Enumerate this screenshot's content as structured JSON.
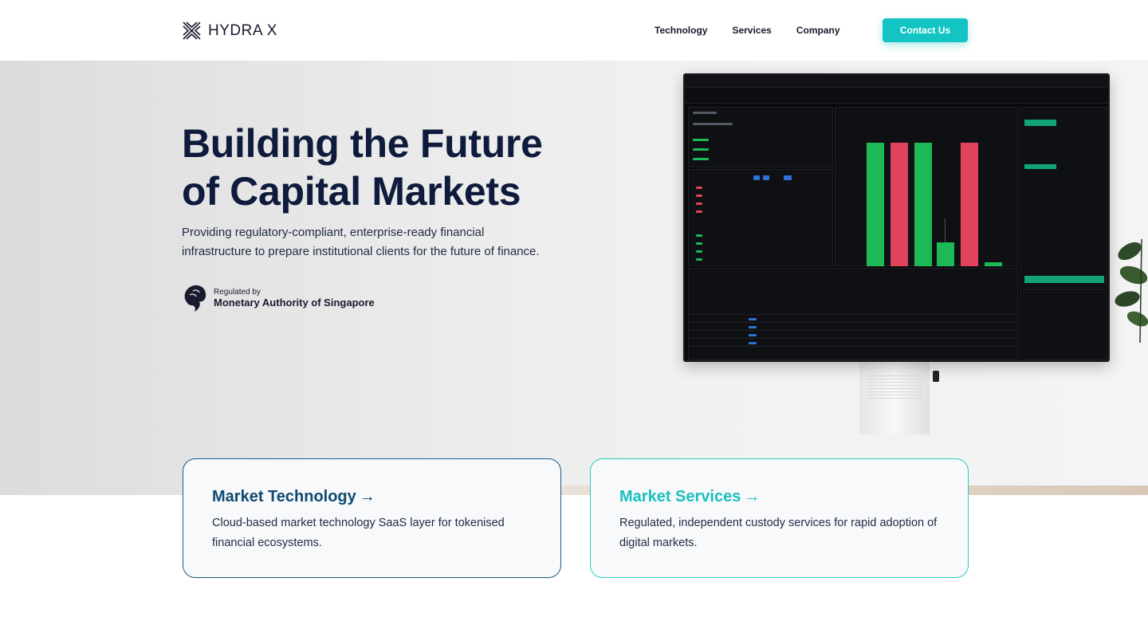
{
  "header": {
    "brand": "HYDRA X",
    "nav": [
      "Technology",
      "Services",
      "Company"
    ],
    "contact_label": "Contact Us",
    "accent": "#14c4c4"
  },
  "hero": {
    "title_line1": "Building the Future",
    "title_line2": "of Capital Markets",
    "subtitle": "Providing regulatory-compliant, enterprise-ready financial infrastructure to prepare institutional clients for the future of finance.",
    "regulated_small": "Regulated by",
    "regulated_big": "Monetary Authority of Singapore"
  },
  "cards": [
    {
      "title": "Market Technology",
      "arrow": "→",
      "desc": "Cloud-based market technology SaaS layer for tokenised financial ecosystems.",
      "color": "#0e4a70"
    },
    {
      "title": "Market Services",
      "arrow": "→",
      "desc": "Regulated, independent custody services for rapid adoption of digital markets.",
      "color": "#1bbfbd"
    }
  ]
}
